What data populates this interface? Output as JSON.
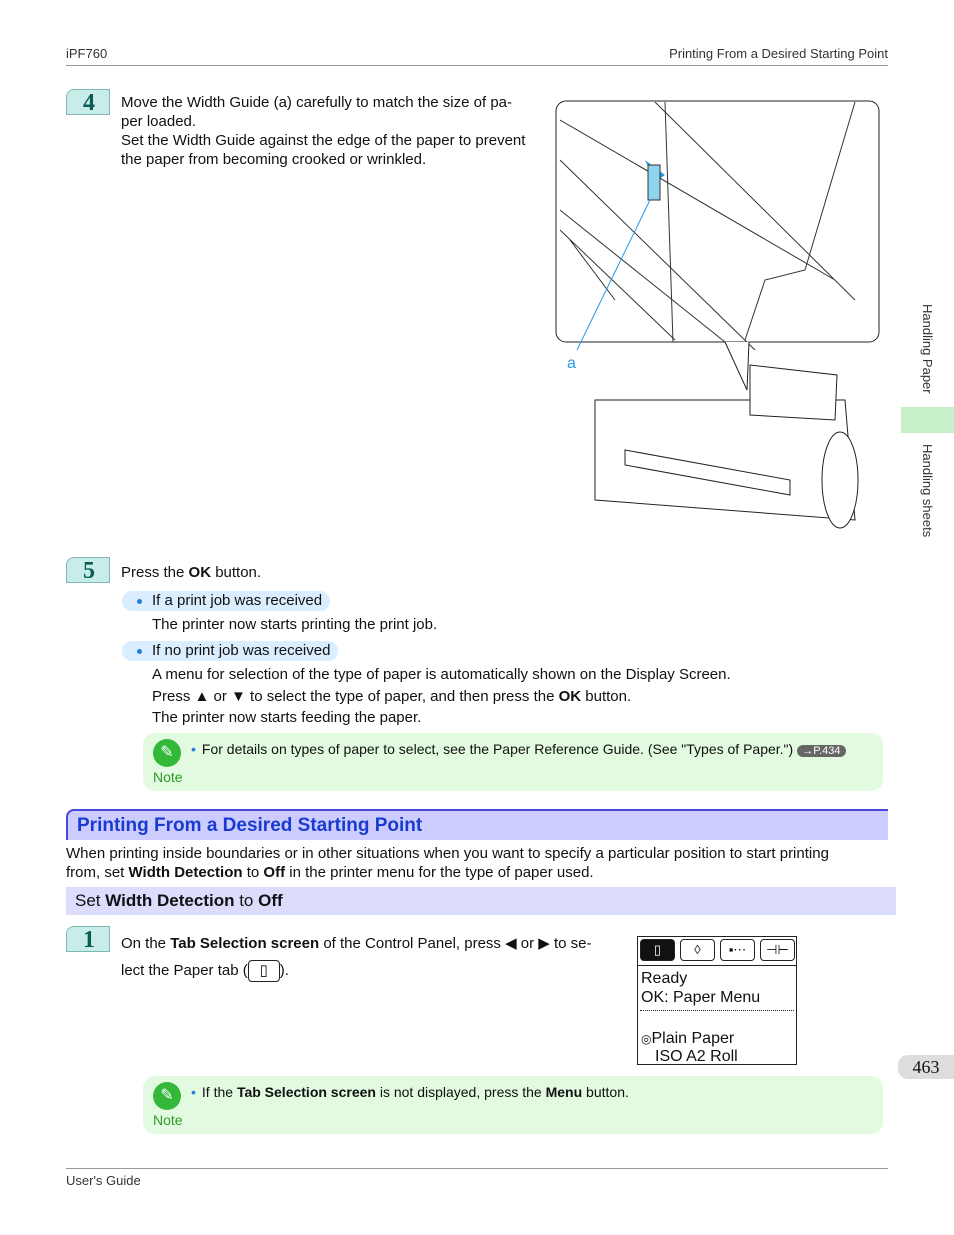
{
  "header": {
    "left": "iPF760",
    "right": "Printing From a Desired Starting Point"
  },
  "footer": {
    "left": "User's Guide"
  },
  "side_tabs": {
    "top": "Handling Paper",
    "bottom": "Handling sheets"
  },
  "page_number": "463",
  "step4": {
    "number": "4",
    "lines": [
      "Move the Width Guide (a) carefully to match the size of pa-",
      "per loaded.",
      "Set the Width Guide against the edge of the paper to prevent",
      "the paper from becoming crooked or wrinkled."
    ],
    "callout": "a"
  },
  "step5": {
    "number": "5",
    "text_pre": "Press the ",
    "text_bold": "OK",
    "text_post": " button.",
    "case1": {
      "label": "If a print job was received",
      "text": "The printer now starts printing the print job."
    },
    "case2": {
      "label": "If no print job was received",
      "line1": "A menu for selection of the type of paper is automatically shown on the Display Screen.",
      "line2_pre": "Press ▲ or ▼ to select the type of paper, and then press the ",
      "line2_bold": "OK",
      "line2_post": " button.",
      "line3": "The printer now starts feeding the paper."
    }
  },
  "note1": {
    "label": "Note",
    "text": "For details on types of paper to select, see the Paper Reference Guide.  (See \"Types of Paper.\")",
    "ref": "→P.434"
  },
  "section": {
    "title": "Printing From a Desired Starting Point",
    "p1_pre": "When printing inside boundaries or in other situations when you want to specify a particular position to start printing",
    "p2_pre": "from, set ",
    "p2_b1": "Width Detection",
    "p2_mid": " to ",
    "p2_b2": "Off",
    "p2_post": " in the printer menu for the type of paper used."
  },
  "subsection": {
    "pre": "Set ",
    "b1": "Width Detection",
    "mid": " to ",
    "b2": "Off"
  },
  "step1": {
    "number": "1",
    "pre": "On the ",
    "bold": "Tab Selection screen",
    "post": " of the Control Panel, press ◀ or ▶ to se-",
    "line2_pre": "lect the Paper tab (",
    "line2_post": ")."
  },
  "lcd": {
    "line1": "Ready",
    "line2": "OK: Paper Menu",
    "line3": "Plain Paper",
    "line4": "ISO A2 Roll"
  },
  "note2": {
    "label": "Note",
    "pre": "If the ",
    "b1": "Tab Selection screen",
    "mid": " is not displayed, press the ",
    "b2": "Menu",
    "post": " button."
  }
}
